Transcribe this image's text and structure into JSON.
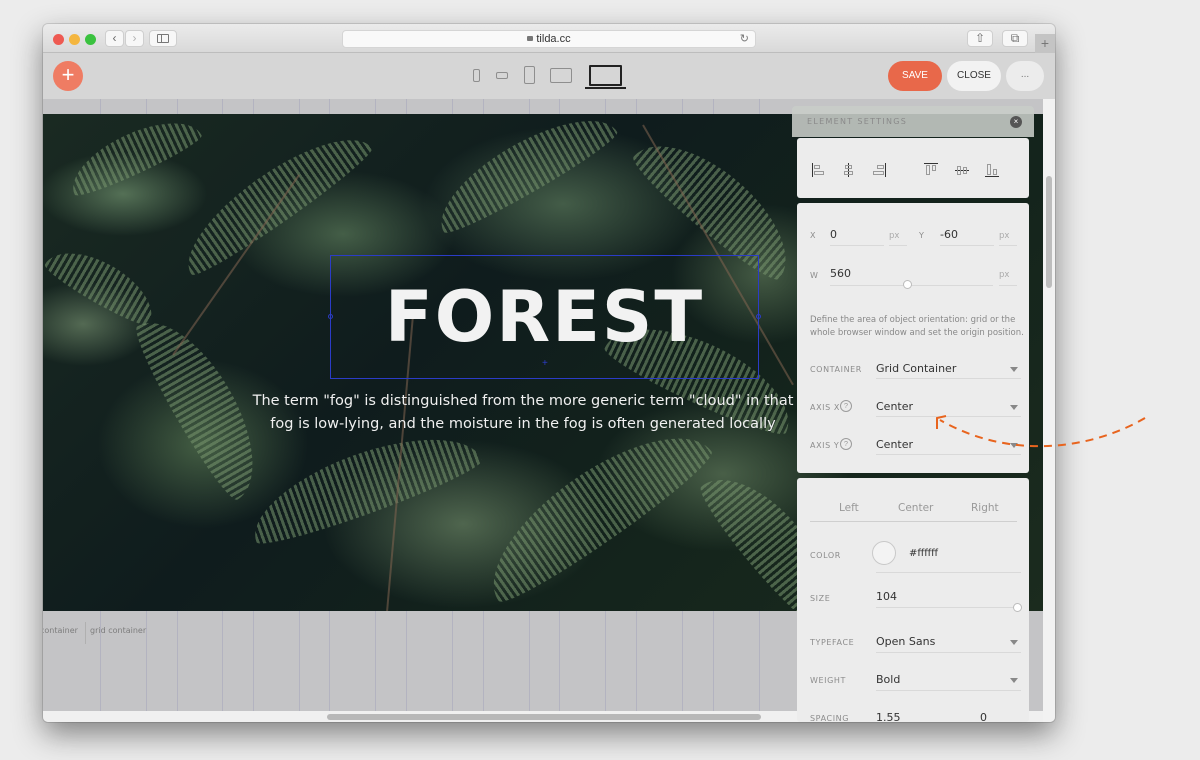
{
  "browser": {
    "url": "tilda.cc",
    "nav_back_glyph": "‹",
    "nav_forward_glyph": "›",
    "reload_glyph": "↻",
    "share_glyph": "⇧",
    "tabs_glyph": "⧉",
    "new_tab_glyph": "+"
  },
  "toolbar": {
    "add_glyph": "+",
    "save_label": "SAVE",
    "close_label": "CLOSE",
    "more_label": "...",
    "devices": [
      "phone-portrait",
      "phone-landscape",
      "tablet-portrait",
      "tablet-landscape",
      "desktop"
    ],
    "active_device": "desktop",
    "accent_color": "#e8684a"
  },
  "canvas": {
    "title": "FOREST",
    "text_line1": "The term \"fog\" is distinguished from the more generic term \"cloud\" in that",
    "text_line2": "fog is low-lying, and the moisture in the fog is often generated locally",
    "label_container": "container",
    "label_grid_container": "grid container",
    "selection_cross": "+"
  },
  "settings": {
    "title": "ELEMENT SETTINGS",
    "close_glyph": "×",
    "alignment": [
      "align-left",
      "align-center-horizontal",
      "align-right",
      "align-top",
      "align-middle-vertical",
      "align-bottom"
    ],
    "x_label": "X",
    "x_value": "0",
    "x_unit": "px",
    "y_label": "Y",
    "y_value": "-60",
    "y_unit": "px",
    "w_label": "W",
    "w_value": "560",
    "w_unit": "px",
    "description": "Define the area of object orientation: grid or the whole browser window and set the origin position.",
    "container_label": "CONTAINER",
    "container_value": "Grid Container",
    "axis_x_label": "AXIS X",
    "axis_x_value": "Center",
    "axis_y_label": "AXIS Y",
    "axis_y_value": "Center",
    "help_glyph": "?",
    "text_align_tabs": [
      "Left",
      "Center",
      "Right"
    ],
    "color_label": "COLOR",
    "color_value": "#ffffff",
    "size_label": "SIZE",
    "size_value": "104",
    "typeface_label": "TYPEFACE",
    "typeface_value": "Open Sans",
    "weight_label": "WEIGHT",
    "weight_value": "Bold",
    "spacing_label": "SPACING",
    "spacing_value": "1.55",
    "spacing_value2": "0"
  },
  "annotation": {
    "arrow_color": "#e8641e"
  }
}
